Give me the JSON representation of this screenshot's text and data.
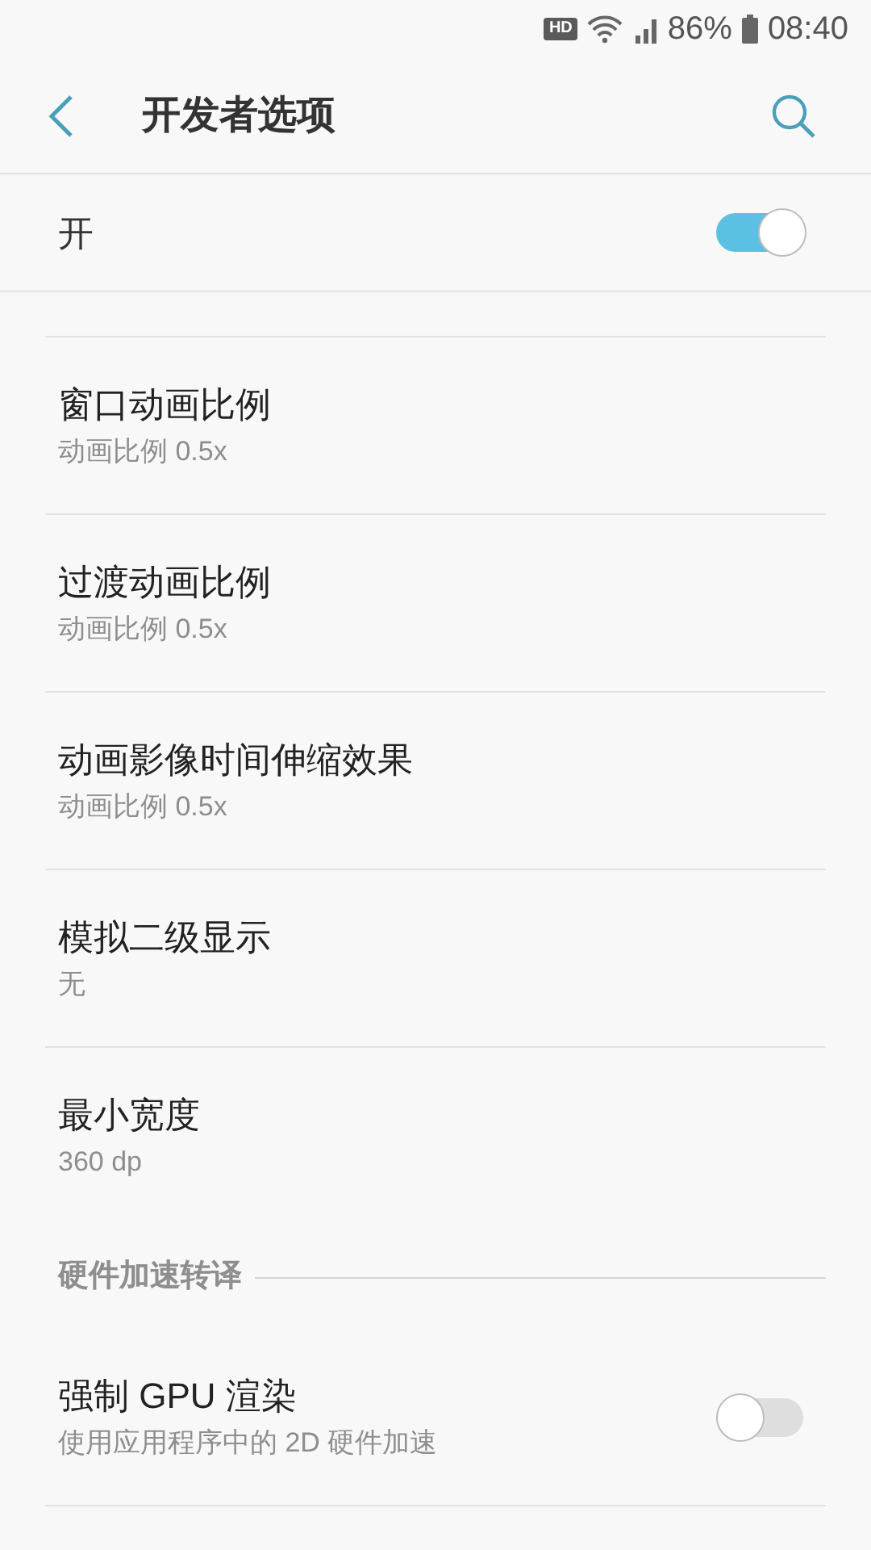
{
  "status_bar": {
    "network": "HD",
    "battery": "86%",
    "time": "08:40"
  },
  "header": {
    "title": "开发者选项"
  },
  "master": {
    "label": "开",
    "on": true
  },
  "items": [
    {
      "kind": "setting",
      "title": "窗口动画比例",
      "summary": "动画比例 0.5x"
    },
    {
      "kind": "setting",
      "title": "过渡动画比例",
      "summary": "动画比例 0.5x"
    },
    {
      "kind": "setting",
      "title": "动画影像时间伸缩效果",
      "summary": "动画比例 0.5x"
    },
    {
      "kind": "setting",
      "title": "模拟二级显示",
      "summary": "无"
    },
    {
      "kind": "setting",
      "title": "最小宽度",
      "summary": "360 dp"
    },
    {
      "kind": "section",
      "title": "硬件加速转译"
    },
    {
      "kind": "toggle",
      "title": "强制 GPU 渲染",
      "summary": "使用应用程序中的 2D 硬件加速",
      "on": false
    }
  ]
}
